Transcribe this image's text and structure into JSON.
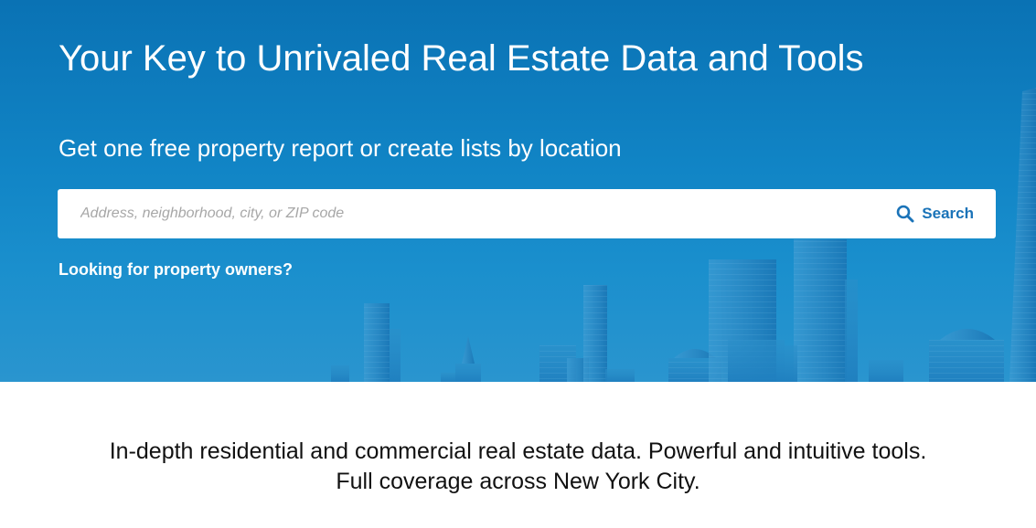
{
  "hero": {
    "title": "Your Key to Unrivaled Real Estate Data and Tools",
    "subtitle": "Get one free property report or create lists by location",
    "background_color": "#1185c6",
    "search": {
      "placeholder": "Address, neighborhood, city, or ZIP code",
      "value": "",
      "button_label": "Search",
      "button_icon": "search-icon",
      "accent_color": "#1a73b8"
    },
    "owners_link": "Looking for property owners?"
  },
  "tagline": {
    "line1": "In-depth residential and commercial real estate data. Powerful and intuitive tools.",
    "line2": "Full coverage across New York City."
  }
}
